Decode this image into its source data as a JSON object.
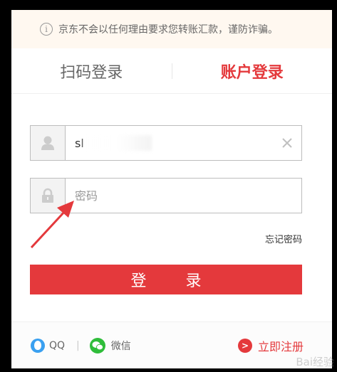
{
  "notice": {
    "text": "京东不会以任何理由要求您转账汇款，谨防诈骗。"
  },
  "tabs": {
    "qr_label": "扫码登录",
    "account_label": "账户登录"
  },
  "username": {
    "value": "sl"
  },
  "password": {
    "placeholder": "密码"
  },
  "forgot_label": "忘记密码",
  "login_label": "登 录",
  "bottom": {
    "qq_label": "QQ",
    "wechat_label": "微信",
    "register_label": "立即注册"
  },
  "colors": {
    "brand_red": "#e4393c",
    "notice_bg": "#fff8f0",
    "wechat_green": "#2fbd3a",
    "qq_blue": "#3aa0f0"
  }
}
